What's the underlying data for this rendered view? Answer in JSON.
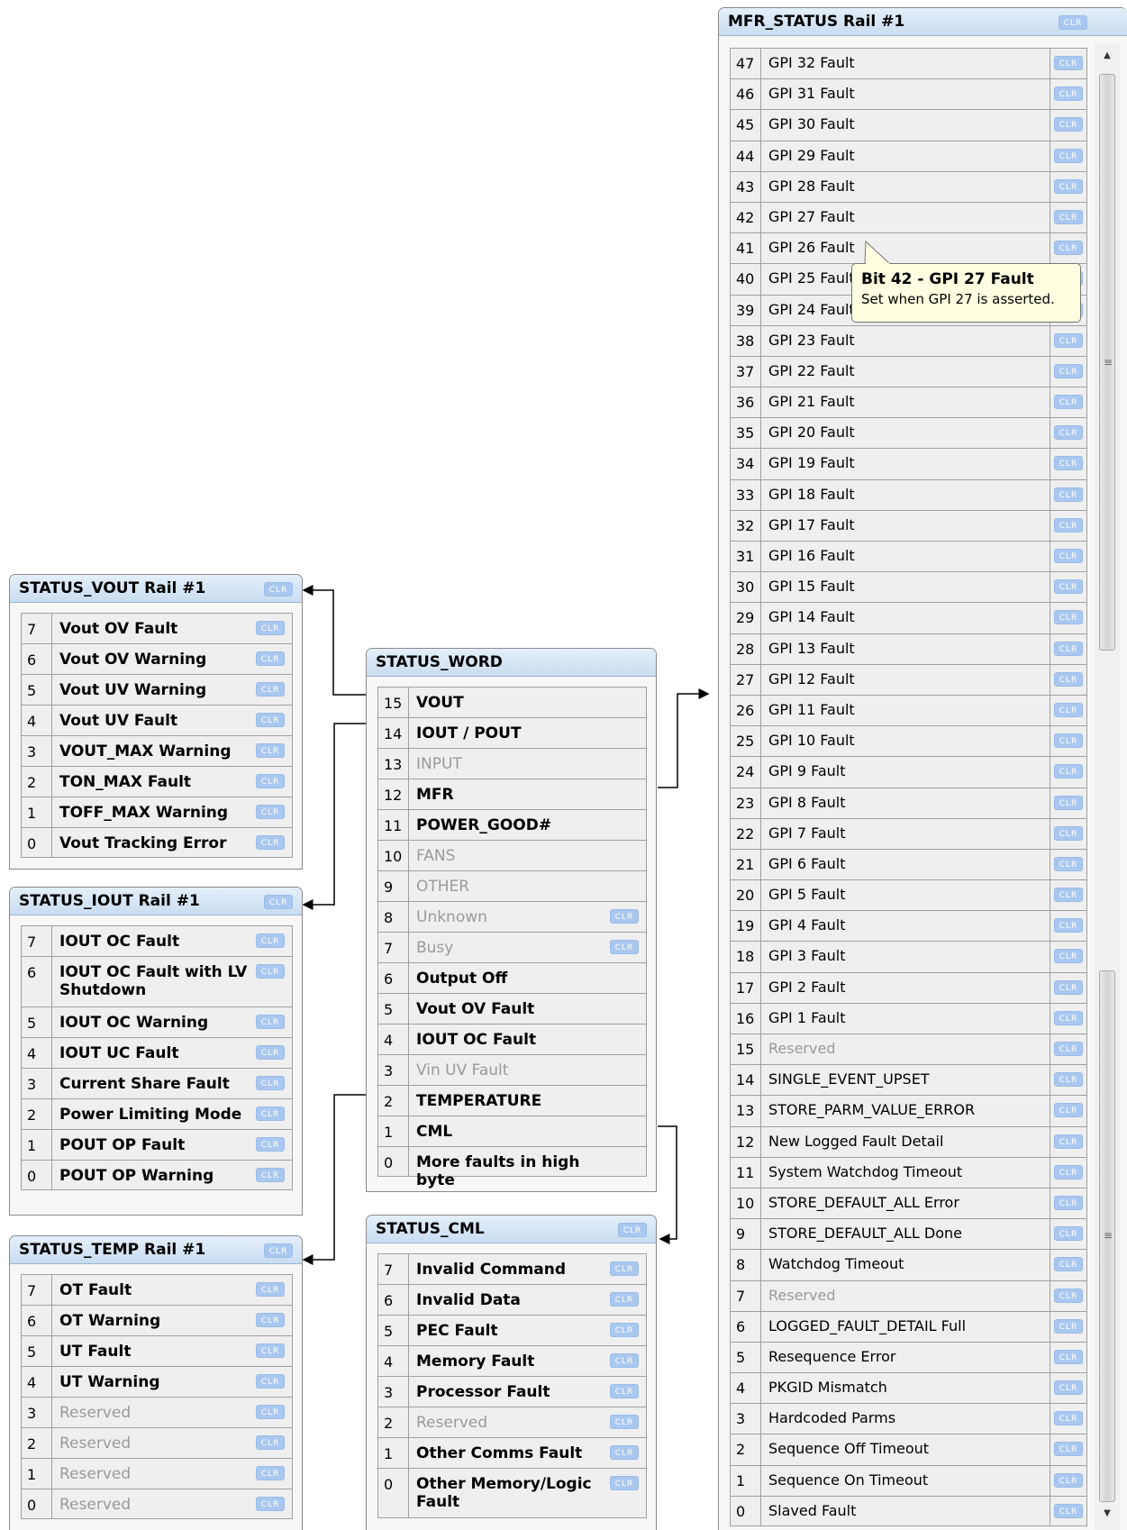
{
  "clr_label": "CLR",
  "status_vout": {
    "title": "STATUS_VOUT Rail #1",
    "rows": [
      {
        "bit": "7",
        "label": "Vout OV Fault"
      },
      {
        "bit": "6",
        "label": "Vout OV Warning"
      },
      {
        "bit": "5",
        "label": "Vout UV Warning"
      },
      {
        "bit": "4",
        "label": "Vout UV Fault"
      },
      {
        "bit": "3",
        "label": "VOUT_MAX Warning"
      },
      {
        "bit": "2",
        "label": "TON_MAX Fault"
      },
      {
        "bit": "1",
        "label": "TOFF_MAX Warning"
      },
      {
        "bit": "0",
        "label": "Vout Tracking Error"
      }
    ]
  },
  "status_iout": {
    "title": "STATUS_IOUT Rail #1",
    "rows": [
      {
        "bit": "7",
        "label": "IOUT OC Fault"
      },
      {
        "bit": "6",
        "label": "IOUT OC Fault with LV Shutdown"
      },
      {
        "bit": "5",
        "label": "IOUT OC Warning"
      },
      {
        "bit": "4",
        "label": "IOUT UC Fault"
      },
      {
        "bit": "3",
        "label": "Current Share Fault"
      },
      {
        "bit": "2",
        "label": "Power Limiting Mode"
      },
      {
        "bit": "1",
        "label": "POUT OP Fault"
      },
      {
        "bit": "0",
        "label": "POUT OP Warning"
      }
    ]
  },
  "status_temp": {
    "title": "STATUS_TEMP Rail #1",
    "rows": [
      {
        "bit": "7",
        "label": "OT Fault"
      },
      {
        "bit": "6",
        "label": "OT Warning"
      },
      {
        "bit": "5",
        "label": "UT Fault"
      },
      {
        "bit": "4",
        "label": "UT Warning"
      },
      {
        "bit": "3",
        "label": "Reserved"
      },
      {
        "bit": "2",
        "label": "Reserved"
      },
      {
        "bit": "1",
        "label": "Reserved"
      },
      {
        "bit": "0",
        "label": "Reserved"
      }
    ]
  },
  "status_word": {
    "title": "STATUS_WORD",
    "rows": [
      {
        "bit": "15",
        "label": "VOUT"
      },
      {
        "bit": "14",
        "label": "IOUT / POUT"
      },
      {
        "bit": "13",
        "label": "INPUT"
      },
      {
        "bit": "12",
        "label": "MFR"
      },
      {
        "bit": "11",
        "label": "POWER_GOOD#"
      },
      {
        "bit": "10",
        "label": "FANS"
      },
      {
        "bit": "9",
        "label": "OTHER"
      },
      {
        "bit": "8",
        "label": "Unknown"
      },
      {
        "bit": "7",
        "label": "Busy"
      },
      {
        "bit": "6",
        "label": "Output Off"
      },
      {
        "bit": "5",
        "label": "Vout OV Fault"
      },
      {
        "bit": "4",
        "label": "IOUT OC Fault"
      },
      {
        "bit": "3",
        "label": "Vin UV Fault"
      },
      {
        "bit": "2",
        "label": "TEMPERATURE"
      },
      {
        "bit": "1",
        "label": "CML"
      },
      {
        "bit": "0",
        "label": "More faults in high byte"
      }
    ]
  },
  "status_cml": {
    "title": "STATUS_CML",
    "rows": [
      {
        "bit": "7",
        "label": "Invalid Command"
      },
      {
        "bit": "6",
        "label": "Invalid Data"
      },
      {
        "bit": "5",
        "label": "PEC Fault"
      },
      {
        "bit": "4",
        "label": "Memory Fault"
      },
      {
        "bit": "3",
        "label": "Processor Fault"
      },
      {
        "bit": "2",
        "label": "Reserved"
      },
      {
        "bit": "1",
        "label": "Other Comms Fault"
      },
      {
        "bit": "0",
        "label": "Other Memory/Logic Fault"
      }
    ]
  },
  "mfr_status": {
    "title": "MFR_STATUS Rail #1",
    "rows": [
      {
        "bit": "47",
        "label": "GPI 32 Fault"
      },
      {
        "bit": "46",
        "label": "GPI 31 Fault"
      },
      {
        "bit": "45",
        "label": "GPI 30 Fault"
      },
      {
        "bit": "44",
        "label": "GPI 29 Fault"
      },
      {
        "bit": "43",
        "label": "GPI 28 Fault"
      },
      {
        "bit": "42",
        "label": "GPI 27 Fault"
      },
      {
        "bit": "41",
        "label": "GPI 26 Fault"
      },
      {
        "bit": "40",
        "label": "GPI 25 Fault"
      },
      {
        "bit": "39",
        "label": "GPI 24 Fault"
      },
      {
        "bit": "38",
        "label": "GPI 23 Fault"
      },
      {
        "bit": "37",
        "label": "GPI 22 Fault"
      },
      {
        "bit": "36",
        "label": "GPI 21 Fault"
      },
      {
        "bit": "35",
        "label": "GPI 20 Fault"
      },
      {
        "bit": "34",
        "label": "GPI 19 Fault"
      },
      {
        "bit": "33",
        "label": "GPI 18 Fault"
      },
      {
        "bit": "32",
        "label": "GPI 17 Fault"
      },
      {
        "bit": "31",
        "label": "GPI 16 Fault"
      },
      {
        "bit": "30",
        "label": "GPI 15 Fault"
      },
      {
        "bit": "29",
        "label": "GPI 14 Fault"
      },
      {
        "bit": "28",
        "label": "GPI 13 Fault"
      },
      {
        "bit": "27",
        "label": "GPI 12 Fault"
      },
      {
        "bit": "26",
        "label": "GPI 11 Fault"
      },
      {
        "bit": "25",
        "label": "GPI 10 Fault"
      },
      {
        "bit": "24",
        "label": "GPI 9 Fault"
      },
      {
        "bit": "23",
        "label": "GPI 8 Fault"
      },
      {
        "bit": "22",
        "label": "GPI 7 Fault"
      },
      {
        "bit": "21",
        "label": "GPI 6 Fault"
      },
      {
        "bit": "20",
        "label": "GPI 5 Fault"
      },
      {
        "bit": "19",
        "label": "GPI 4 Fault"
      },
      {
        "bit": "18",
        "label": "GPI 3 Fault"
      },
      {
        "bit": "17",
        "label": "GPI 2 Fault"
      },
      {
        "bit": "16",
        "label": "GPI 1 Fault"
      },
      {
        "bit": "15",
        "label": "Reserved"
      },
      {
        "bit": "14",
        "label": "SINGLE_EVENT_UPSET"
      },
      {
        "bit": "13",
        "label": "STORE_PARM_VALUE_ERROR"
      },
      {
        "bit": "12",
        "label": "New Logged Fault Detail"
      },
      {
        "bit": "11",
        "label": "System Watchdog Timeout"
      },
      {
        "bit": "10",
        "label": "STORE_DEFAULT_ALL Error"
      },
      {
        "bit": "9",
        "label": "STORE_DEFAULT_ALL Done"
      },
      {
        "bit": "8",
        "label": "Watchdog Timeout"
      },
      {
        "bit": "7",
        "label": "Reserved"
      },
      {
        "bit": "6",
        "label": "LOGGED_FAULT_DETAIL Full"
      },
      {
        "bit": "5",
        "label": "Resequence Error"
      },
      {
        "bit": "4",
        "label": "PKGID Mismatch"
      },
      {
        "bit": "3",
        "label": "Hardcoded Parms"
      },
      {
        "bit": "2",
        "label": "Sequence Off Timeout"
      },
      {
        "bit": "1",
        "label": "Sequence On Timeout"
      },
      {
        "bit": "0",
        "label": "Slaved Fault"
      }
    ]
  },
  "tooltip": {
    "title": "Bit 42 - GPI 27 Fault",
    "text": "Set when GPI 27 is asserted."
  }
}
